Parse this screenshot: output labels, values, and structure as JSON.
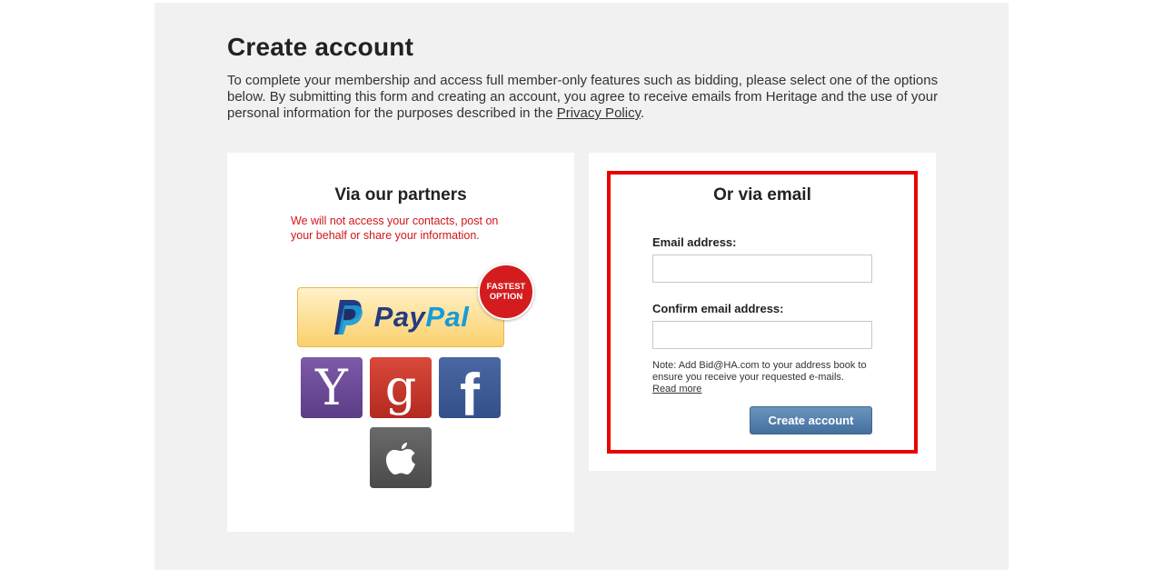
{
  "page": {
    "title": "Create account",
    "intro_text": "To complete your membership and access full member-only features such as bidding, please select one of the options below. By submitting this form and creating an account, you agree to receive emails from Heritage and the use of your personal information for the purposes described in the ",
    "privacy_link": "Privacy Policy",
    "intro_end": "."
  },
  "partners": {
    "title": "Via our partners",
    "note": "We will not access your contacts, post on your behalf or share your information.",
    "paypal": {
      "word_pay": "Pay",
      "word_pal": "Pal",
      "icon": "paypal-icon"
    },
    "badge": {
      "line1": "FASTEST",
      "line2": "OPTION"
    },
    "social": [
      {
        "name": "Yahoo",
        "glyph": "Y",
        "icon": "yahoo-icon",
        "color": "#6b4a99"
      },
      {
        "name": "Google",
        "glyph": "g",
        "icon": "google-icon",
        "color": "#c8372c"
      },
      {
        "name": "Facebook",
        "glyph": "f",
        "icon": "facebook-icon",
        "color": "#3f5c97"
      },
      {
        "name": "Apple",
        "glyph": "",
        "icon": "apple-icon",
        "color": "#595959"
      }
    ]
  },
  "email_form": {
    "title": "Or via email",
    "email_label": "Email address:",
    "email_value": "",
    "confirm_label": "Confirm email address:",
    "confirm_value": "",
    "note": "Note: Add Bid@HA.com to your address book to ensure you receive your requested e-mails.",
    "read_more": "Read more",
    "submit_label": "Create account",
    "highlight_color": "#e90000"
  }
}
